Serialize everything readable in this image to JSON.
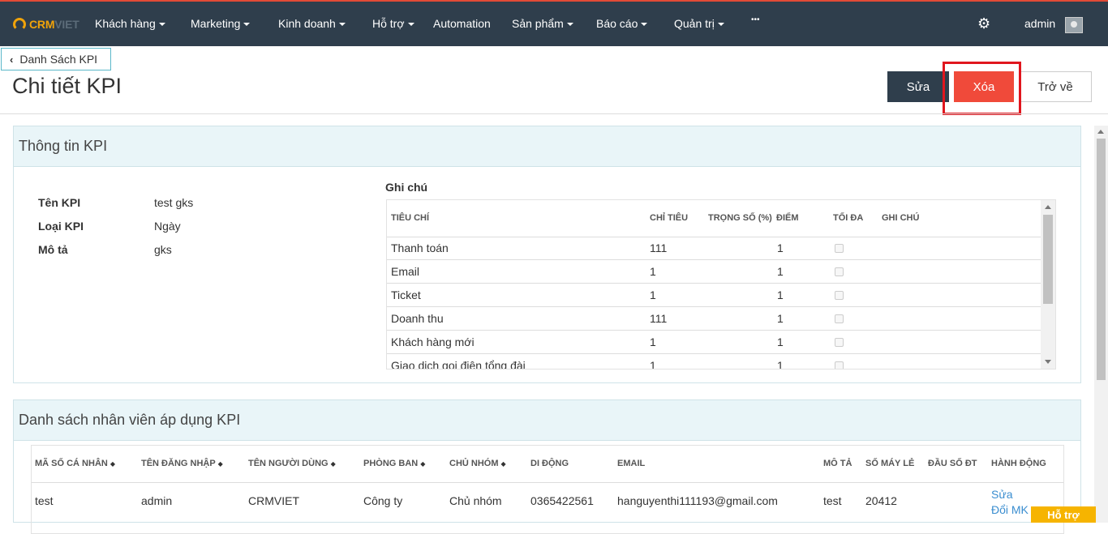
{
  "brand": {
    "logo_crm": "CRM",
    "logo_viet": "VIET",
    "accent": "#f0a30a",
    "nav_bg": "#2f3e4c"
  },
  "nav": {
    "items": [
      {
        "label": "Khách hàng"
      },
      {
        "label": "Marketing"
      },
      {
        "label": "Kinh doanh"
      },
      {
        "label": "Hỗ trợ"
      },
      {
        "label": "Automation"
      },
      {
        "label": "Sản phẩm"
      },
      {
        "label": "Báo cáo"
      },
      {
        "label": "Quản trị"
      },
      {
        "label": "•••"
      }
    ],
    "user": "admin"
  },
  "header": {
    "back_label": "Danh Sách KPI",
    "title": "Chi tiết KPI",
    "edit_label": "Sửa",
    "delete_label": "Xóa",
    "return_label": "Trở về",
    "delete_color": "#f04a3a"
  },
  "kpi_info": {
    "panel_title": "Thông tin KPI",
    "fields": [
      {
        "label": "Tên KPI",
        "value": "test gks"
      },
      {
        "label": "Loại KPI",
        "value": "Ngày"
      },
      {
        "label": "Mô tả",
        "value": "gks"
      }
    ],
    "note_title": "Ghi chú",
    "criteria_headers": [
      "TIÊU CHÍ",
      "CHỈ TIÊU",
      "TRỌNG SỐ (%)",
      "ĐIỂM",
      "TỐI ĐA",
      "GHI CHÚ"
    ],
    "criteria": [
      {
        "name": "Thanh toán",
        "target": "111",
        "points": "1"
      },
      {
        "name": "Email",
        "target": "1",
        "points": "1"
      },
      {
        "name": "Ticket",
        "target": "1",
        "points": "1"
      },
      {
        "name": "Doanh thu",
        "target": "111",
        "points": "1"
      },
      {
        "name": "Khách hàng mới",
        "target": "1",
        "points": "1"
      },
      {
        "name": "Giao dịch gọi điện tổng đài",
        "target": "1",
        "points": "1"
      }
    ]
  },
  "employees": {
    "panel_title": "Danh sách nhân viên áp dụng KPI",
    "headers": [
      "MÃ SỐ CÁ NHÂN",
      "TÊN ĐĂNG NHẬP",
      "TÊN NGƯỜI DÙNG",
      "PHÒNG BAN",
      "CHỦ NHÓM",
      "DI ĐỘNG",
      "EMAIL",
      "MÔ TẢ",
      "SỐ MÁY LẺ",
      "ĐẦU SỐ ĐT",
      "HÀNH ĐỘNG"
    ],
    "rows": [
      {
        "id": "test",
        "username": "admin",
        "fullname": "CRMVIET",
        "department": "Công ty",
        "owner": "Chủ nhóm",
        "mobile": "0365422561",
        "email": "hanguyenthi111193@gmail.com",
        "description": "test",
        "extension": "20412",
        "prefix": "",
        "actions": [
          "Sửa",
          "Đổi MK"
        ]
      }
    ]
  },
  "support_label": "Hỗ trợ"
}
